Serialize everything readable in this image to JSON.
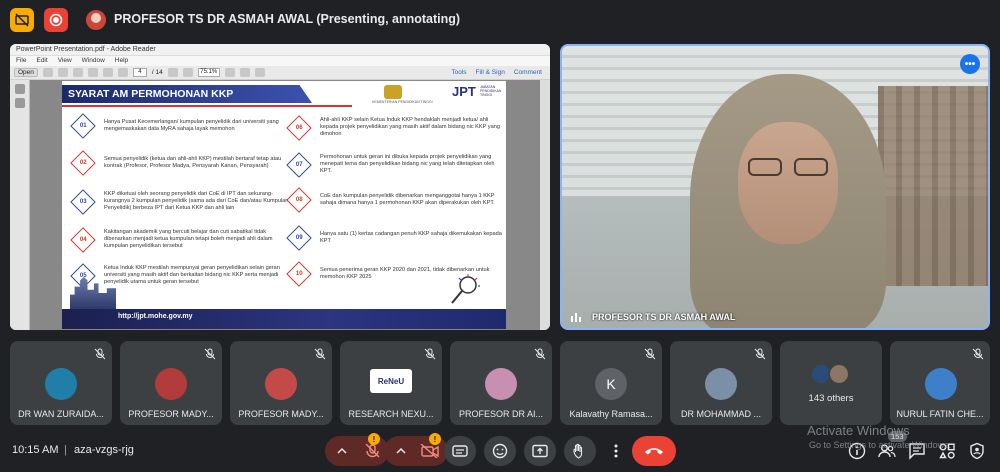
{
  "topbar": {
    "presenter_label": "PROFESOR TS DR ASMAH AWAL (Presenting, annotating)"
  },
  "reader": {
    "window_title": "PowerPoint Presentation.pdf - Adobe Reader",
    "menu": [
      "File",
      "Edit",
      "View",
      "Window",
      "Help"
    ],
    "open_label": "Open",
    "page_current": "4",
    "page_total": "/ 14",
    "zoom": "75.1%",
    "tools_label": "Tools",
    "fill_sign_label": "Fill & Sign",
    "comment_label": "Comment"
  },
  "slide": {
    "title": "SYARAT AM PERMOHONAN KKP",
    "ministry_text": "KEMENTERIAN PENDIDIKAN TINGGI",
    "jpt_logo": "JPT",
    "jpt_sub": "JABATAN PENDIDIKAN TINGGI",
    "footer_url": "http://jpt.mohe.gov.my",
    "items_left": [
      {
        "num": "01",
        "text": "Hanya Pusat Kecemerlangan/ kumpulan penyelidik dari universiti yang mengemaskakan data MyRA sahaja layak memohon"
      },
      {
        "num": "02",
        "text": "Semua penyelidik (ketua dan ahli-ahli KKP) mestilah bertaraf tetap atau kontrak (Profesor, Profesor Madya, Pensyarah Kanan, Pensyarah)"
      },
      {
        "num": "03",
        "text": "KKP diketuai oleh seorang penyelidik dari CoE di IPT dan sekurang-kurangnya 2 kumpulan penyelidik (sama ada dari CoE dan/atau Kumpulan Penyelidik) berbeza IPT dari Ketua KKP dan ahli lain"
      },
      {
        "num": "04",
        "text": "Kakitangan akademik yang bercuti belajar dan cuti sabatikal tidak dibenarkan menjadi ketua kumpulan tetapi boleh menjadi ahli dalam kumpulan penyelidikan tersebut"
      },
      {
        "num": "05",
        "text": "Ketua Induk KKP mestilah mempunyai geran penyelidikan selain geran universiti yang masih aktif dan berkaitan bidang nic KKP serta menjadi penyelidik utama untuk geran tersebut"
      }
    ],
    "items_right": [
      {
        "num": "06",
        "text": "Ahli-ahli KKP selain Ketua Induk KKP hendaklah menjadi ketua/ ahli kepada projek penyelidikan yang masih aktif dalam bidang nic KKP yang dimohon"
      },
      {
        "num": "07",
        "text": "Permohonan untuk geran ini dibuka kepada projek penyelidikan yang menepati tema dan penyelidikan bidang nic yang telah ditetapkan oleh KPT."
      },
      {
        "num": "08",
        "text": "CoE dan kumpulan penyelidik dibenarkan menganggotai hanya 1 KKP sahaja dimana hanya 1 permohonan KKP akan diperakukan oleh KPT."
      },
      {
        "num": "09",
        "text": "Hanya satu (1) kertas cadangan penuh KKP sahaja dikemukakan kepada KPT"
      },
      {
        "num": "10",
        "text": "Semua penerima geran KKP 2020 dan 2021, tidak dibenarkan untuk memohon KKP 2025"
      }
    ]
  },
  "speaker": {
    "name": "PROFESOR TS DR ASMAH AWAL"
  },
  "participants": [
    {
      "name": "DR WAN ZURAIDA...",
      "avatar_color": "#1f7fa8"
    },
    {
      "name": "PROFESOR MADY...",
      "avatar_color": "#b23b3b"
    },
    {
      "name": "PROFESOR MADY...",
      "avatar_color": "#c44a4a"
    },
    {
      "name": "RESEARCH NEXU...",
      "logo_text": "ReNeU"
    },
    {
      "name": "PROFESOR DR AI...",
      "avatar_color": "#c78fb0"
    },
    {
      "name": "Kalavathy Ramasa...",
      "initial": "K"
    },
    {
      "name": "DR MOHAMMAD ...",
      "avatar_color": "#7b8fa6"
    },
    {
      "name": "143 others",
      "others": true
    },
    {
      "name": "NURUL FATIN CHE...",
      "avatar_color": "#3d7fc8"
    }
  ],
  "bottombar": {
    "time": "10:15 AM",
    "separator": "|",
    "meeting_code": "aza-vzgs-rjg",
    "people_count": "153"
  },
  "watermark": {
    "line1": "Activate Windows",
    "line2": "Go to Settings to activate Windows."
  },
  "colors": {
    "accent_blue": "#8ab4f8",
    "danger_red": "#ea4335",
    "warning_yellow": "#f9ab00",
    "tile_bg": "#3c4043"
  }
}
